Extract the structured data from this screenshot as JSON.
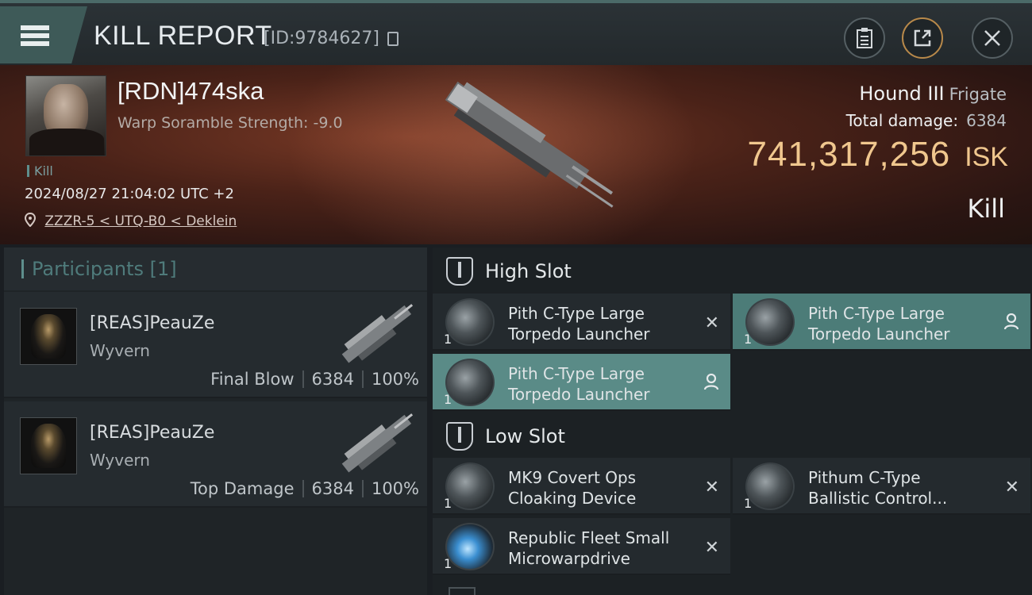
{
  "window": {
    "title": "KILL REPORT",
    "report_id": "[ID:9784627]"
  },
  "victim": {
    "name": "[RDN]474ska",
    "warp_strength": "Warp Soramble Strength: -9.0",
    "tag": "Kill",
    "timestamp": "2024/08/27 21:04:02 UTC +2",
    "location": "ZZZR-5 < UTQ-B0 < Deklein",
    "ship_name": "Hound III",
    "ship_class": "Frigate",
    "total_damage_label": "Total damage:",
    "total_damage": "6384",
    "isk_value": "741,317,256",
    "isk_unit": "ISK",
    "result": "Kill"
  },
  "participants": {
    "header": "Participants [1]",
    "rows": [
      {
        "name": "[REAS]PeauZe",
        "ship": "Wyvern",
        "role": "Final Blow",
        "damage": "6384",
        "percent": "100%"
      },
      {
        "name": "[REAS]PeauZe",
        "ship": "Wyvern",
        "role": "Top Damage",
        "damage": "6384",
        "percent": "100%"
      }
    ]
  },
  "slots": {
    "high": {
      "title": "High Slot",
      "modules": [
        {
          "line1": "Pith C-Type Large",
          "line2": "Torpedo Launcher",
          "qty": "1",
          "status": "destroyed",
          "action_icon": "close-icon"
        },
        {
          "line1": "Pith C-Type Large",
          "line2": "Torpedo Launcher",
          "qty": "1",
          "status": "dropped",
          "action_icon": "person-icon"
        },
        {
          "line1": "Pith C-Type Large",
          "line2": "Torpedo Launcher",
          "qty": "1",
          "status": "dropped",
          "action_icon": "person-icon"
        }
      ]
    },
    "low": {
      "title": "Low Slot",
      "modules": [
        {
          "line1": "MK9 Covert Ops",
          "line2": "Cloaking Device",
          "qty": "1",
          "status": "destroyed",
          "action_icon": "close-icon"
        },
        {
          "line1": "Pithum C-Type",
          "line2": "Ballistic Control...",
          "qty": "1",
          "status": "destroyed",
          "action_icon": "close-icon"
        },
        {
          "line1": "Republic Fleet Small",
          "line2": "Microwarpdrive",
          "qty": "1",
          "status": "destroyed",
          "action_icon": "close-icon"
        }
      ]
    }
  },
  "colors": {
    "accent_teal": "#5e8f8d",
    "isk_gold": "#f0c78e",
    "fitted_green": "#5a8b87"
  }
}
